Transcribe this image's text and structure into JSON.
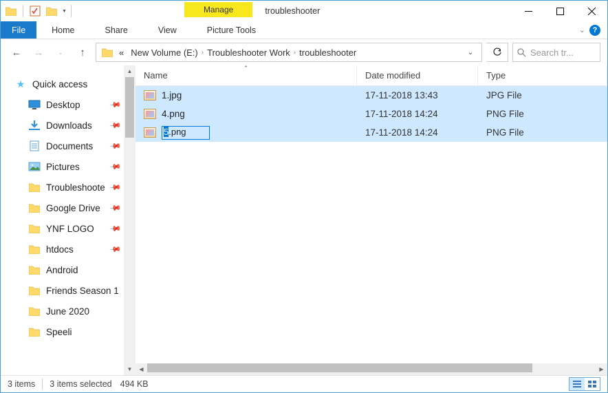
{
  "titlebar": {
    "context_tab": "Manage",
    "title": "troubleshooter"
  },
  "ribbon": {
    "file": "File",
    "tabs": [
      "Home",
      "Share",
      "View"
    ],
    "context_tabs": [
      "Picture Tools"
    ]
  },
  "breadcrumbs": {
    "items": [
      "New Volume (E:)",
      "Troubleshooter Work",
      "troubleshooter"
    ]
  },
  "search": {
    "placeholder": "Search tr..."
  },
  "nav": {
    "quick_access": "Quick access",
    "items": [
      {
        "label": "Desktop",
        "icon": "desktop",
        "pinned": true
      },
      {
        "label": "Downloads",
        "icon": "downloads",
        "pinned": true
      },
      {
        "label": "Documents",
        "icon": "documents",
        "pinned": true
      },
      {
        "label": "Pictures",
        "icon": "pictures",
        "pinned": true
      },
      {
        "label": "Troubleshooter",
        "icon": "folder",
        "pinned": true
      },
      {
        "label": "Google Drive",
        "icon": "folder",
        "pinned": true
      },
      {
        "label": "YNF LOGO",
        "icon": "folder",
        "pinned": true
      },
      {
        "label": "htdocs",
        "icon": "folder",
        "pinned": true
      },
      {
        "label": "Android",
        "icon": "folder",
        "pinned": false
      },
      {
        "label": "Friends Season 1",
        "icon": "folder",
        "pinned": false
      },
      {
        "label": "June 2020",
        "icon": "folder",
        "pinned": false
      },
      {
        "label": "Speeli",
        "icon": "folder",
        "pinned": false
      }
    ]
  },
  "columns": {
    "name": "Name",
    "date": "Date modified",
    "type": "Type"
  },
  "files": [
    {
      "name": "1.jpg",
      "date": "17-11-2018 13:43",
      "type": "JPG File"
    },
    {
      "name": "4.png",
      "date": "17-11-2018 14:24",
      "type": "PNG File"
    },
    {
      "name": "5.png",
      "date": "17-11-2018 14:24",
      "type": "PNG File",
      "renaming": true,
      "sel": "5",
      "rest": ".png"
    }
  ],
  "status": {
    "count": "3 items",
    "selected": "3 items selected",
    "size": "494 KB"
  }
}
